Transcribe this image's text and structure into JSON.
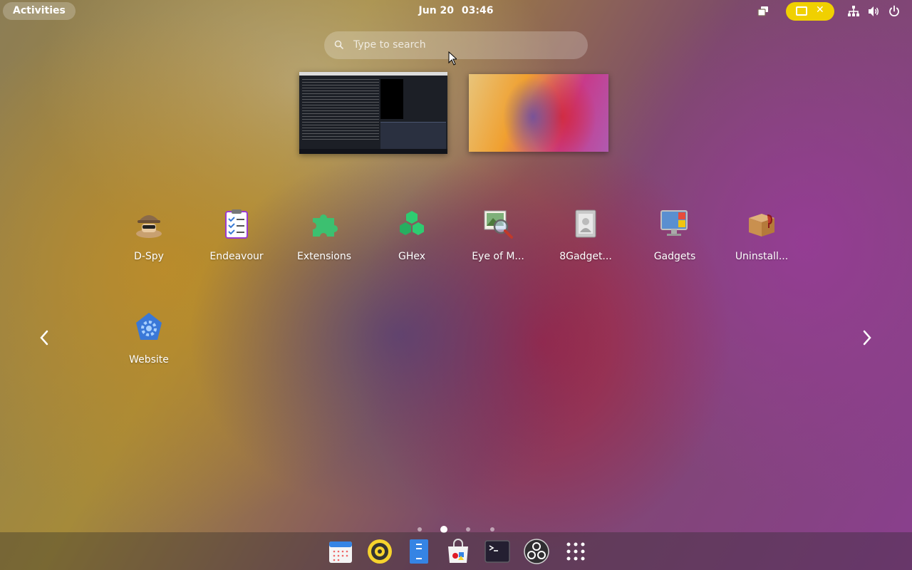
{
  "topbar": {
    "activities_label": "Activities",
    "clock": {
      "date": "Jun 20",
      "time": "03:46"
    },
    "tray": [
      "window-switcher-icon",
      "screen-share-indicator-icon",
      "network-icon",
      "volume-icon",
      "power-icon"
    ],
    "indicator_color": "#f0d000"
  },
  "search": {
    "placeholder": "Type to search"
  },
  "workspaces": [
    "terminal-workspace-thumbnail",
    "desktop-workspace-thumbnail"
  ],
  "apps": [
    {
      "label": "D-Spy",
      "icon": "spy-icon"
    },
    {
      "label": "Endeavour",
      "icon": "checklist-icon"
    },
    {
      "label": "Extensions",
      "icon": "puzzle-icon"
    },
    {
      "label": "GHex",
      "icon": "hexagons-icon"
    },
    {
      "label": "Eye of M...",
      "icon": "image-viewer-icon"
    },
    {
      "label": "8Gadget...",
      "icon": "gadget-pack-icon"
    },
    {
      "label": "Gadgets",
      "icon": "monitor-gadgets-icon"
    },
    {
      "label": "Uninstall...",
      "icon": "wine-box-icon"
    },
    {
      "label": "Website",
      "icon": "gear-globe-icon"
    }
  ],
  "pager": {
    "pages": 4,
    "current_page": 2
  },
  "dock": [
    "calendar-icon",
    "rhythmbox-icon",
    "text-editor-icon",
    "software-store-icon",
    "terminal-icon",
    "obs-icon",
    "show-apps-icon"
  ]
}
